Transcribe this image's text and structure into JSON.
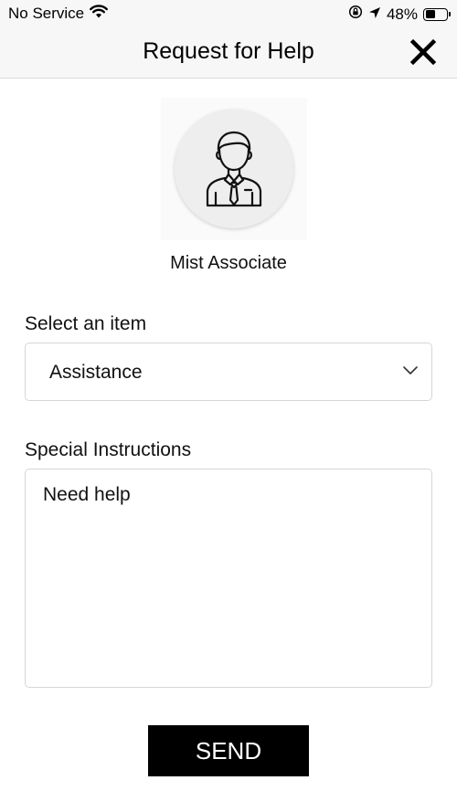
{
  "status_bar": {
    "carrier": "No Service",
    "battery_percent": "48%",
    "battery_level": 0.48
  },
  "nav": {
    "title": "Request for Help",
    "close_icon": "close-icon"
  },
  "associate": {
    "name": "Mist Associate",
    "avatar_icon": "businessman-icon"
  },
  "form": {
    "select_label": "Select an item",
    "selected_item": "Assistance",
    "instructions_label": "Special Instructions",
    "instructions_value": "Need help",
    "send_label": "SEND"
  },
  "colors": {
    "bar_background": "#f7f7f7",
    "button_background": "#000000",
    "button_text": "#ffffff"
  }
}
